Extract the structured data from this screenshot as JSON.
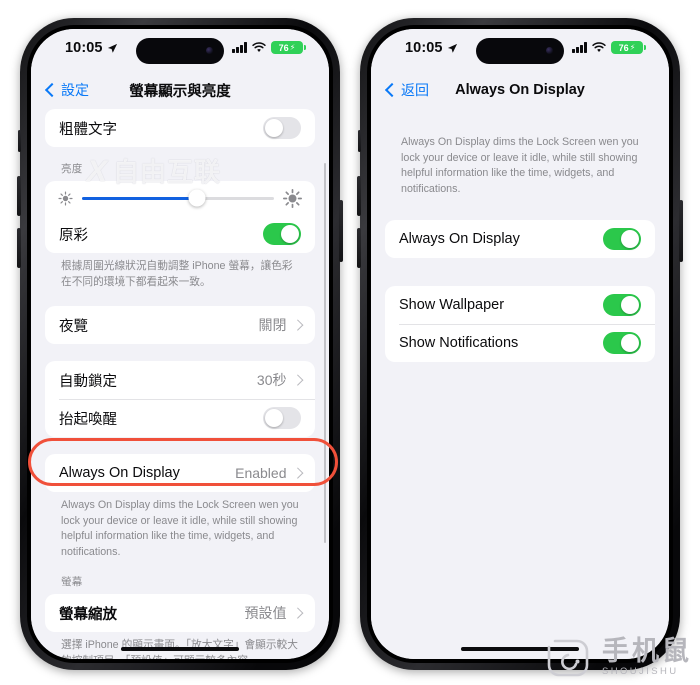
{
  "meta": {
    "accent_blue": "#0a79f7",
    "toggle_green": "#2bc84b",
    "highlight_red": "#f0503a",
    "page_bg": "#f2f2f7"
  },
  "left_phone": {
    "status_bar": {
      "time": "10:05",
      "location_icon": "location-arrow-icon",
      "cellular_icon": "cellular-bars-icon",
      "wifi_icon": "wifi-icon",
      "battery_percent": "76",
      "battery_charging_icon": "bolt-icon"
    },
    "nav": {
      "back_label": "設定",
      "title": "螢幕顯示與亮度"
    },
    "rows": {
      "bold_text": {
        "label": "粗體文字",
        "toggle": "off"
      },
      "brightness_header": "亮度",
      "brightness_value_pct": 60,
      "true_tone": {
        "label": "原彩",
        "toggle": "on"
      },
      "true_tone_footer": "根據周圍光線狀況自動調整 iPhone 螢幕，讓色彩在不同的環境下都看起來一致。",
      "night_shift": {
        "label": "夜覽",
        "value": "關閉"
      },
      "auto_lock": {
        "label": "自動鎖定",
        "value": "30秒"
      },
      "raise_to_wake": {
        "label": "抬起喚醒",
        "toggle": "off"
      },
      "always_on_display": {
        "label": "Always On Display",
        "value": "Enabled"
      },
      "aod_footer": "Always On Display dims the Lock Screen wen you lock your device or leave it idle, while still showing helpful information like the time, widgets, and notifications.",
      "display_header": "螢幕",
      "display_zoom": {
        "label": "螢幕縮放",
        "value": "預設值"
      },
      "display_zoom_footer": "選擇 iPhone 的顯示畫面。「放大文字」會顯示較大的控制項目。「預設值」可顯示較多內容。"
    }
  },
  "right_phone": {
    "status_bar": {
      "time": "10:05",
      "location_icon": "location-arrow-icon",
      "cellular_icon": "cellular-bars-icon",
      "wifi_icon": "wifi-icon",
      "battery_percent": "76",
      "battery_charging_icon": "bolt-icon"
    },
    "nav": {
      "back_label": "返回",
      "title": "Always On Display"
    },
    "intro_footer": "Always On Display dims the Lock Screen wen you lock your device or leave it idle, while still showing helpful information like the time, widgets, and notifications.",
    "rows": {
      "always_on_display": {
        "label": "Always On Display",
        "toggle": "on"
      },
      "show_wallpaper": {
        "label": "Show Wallpaper",
        "toggle": "on"
      },
      "show_notifications": {
        "label": "Show Notifications",
        "toggle": "on"
      }
    }
  },
  "watermarks": {
    "left": {
      "logo": "X",
      "text": "自由互联"
    },
    "bottom_right": {
      "icon": "mouse-outline-icon",
      "cn": "手机鼠",
      "en": "SHOUJISHU"
    }
  }
}
